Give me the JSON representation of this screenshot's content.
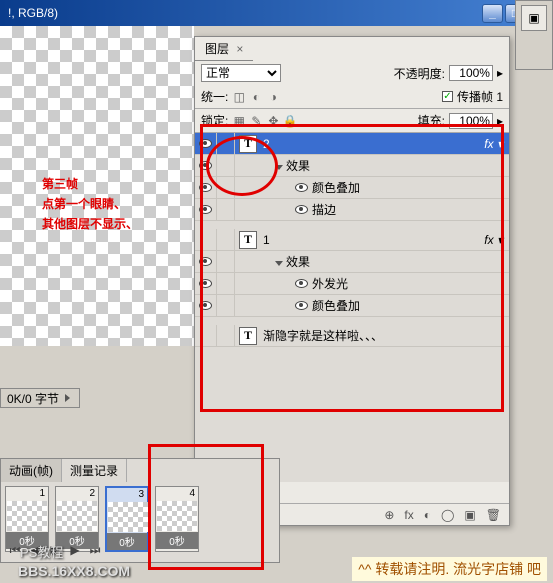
{
  "titlebar": {
    "text": "!, RGB/8)"
  },
  "annotation": {
    "line1": "第三帧",
    "line2": "点第一个眼睛、",
    "line3": "其他图层不显示、"
  },
  "layers_panel": {
    "tab": "图层",
    "blend_mode": "正常",
    "opacity_label": "不透明度:",
    "opacity_value": "100%",
    "unify_label": "统一:",
    "propagate_label": "传播帧 1",
    "lock_label": "锁定:",
    "fill_label": "填充:",
    "fill_value": "100%",
    "layers": [
      {
        "name": "2",
        "type": "T",
        "selected": true,
        "fx": true,
        "effects_label": "效果",
        "effects": [
          "颜色叠加",
          "描边"
        ]
      },
      {
        "name": "1",
        "type": "T",
        "selected": false,
        "fx": true,
        "effects_label": "效果",
        "effects": [
          "外发光",
          "颜色叠加"
        ]
      },
      {
        "name": "渐隐字就是这样啦、、、",
        "type": "T",
        "selected": false,
        "fx": false
      }
    ]
  },
  "status": {
    "text": "0K/0 字节"
  },
  "animation": {
    "tab1": "动画(帧)",
    "tab2": "测量记录",
    "frames": [
      {
        "num": "1",
        "time": "0秒"
      },
      {
        "num": "2",
        "time": "0秒"
      },
      {
        "num": "3",
        "time": "0秒",
        "selected": true
      },
      {
        "num": "4",
        "time": "0秒"
      }
    ]
  },
  "watermarks": {
    "w1": "PS教程",
    "w2": "BBS.16XX8.COM",
    "w3": "^^ 转载请注明. 流光字店铺   吧"
  },
  "footer_icons": [
    "⊕",
    "fx",
    "◐",
    "◯",
    "▣",
    "🗑"
  ]
}
